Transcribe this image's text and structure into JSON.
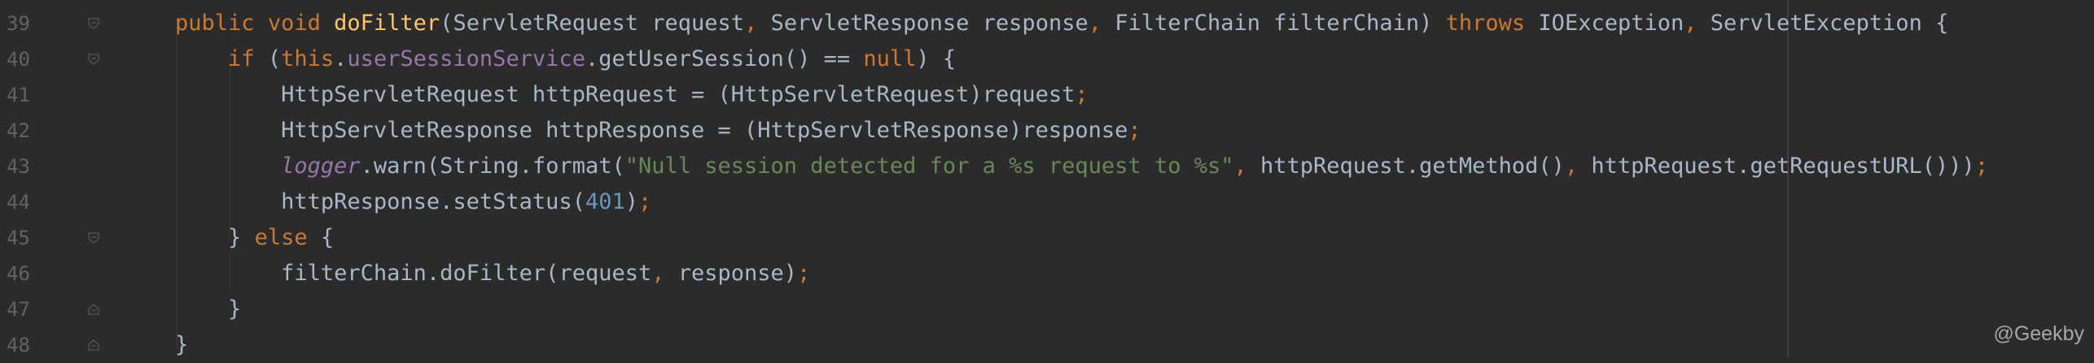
{
  "editor": {
    "line_numbers": [
      "39",
      "40",
      "41",
      "42",
      "43",
      "44",
      "45",
      "46",
      "47",
      "48"
    ],
    "lines": {
      "l39": {
        "indent": "    ",
        "t1": "public",
        "t2": " ",
        "t3": "void",
        "t4": " ",
        "t5": "doFilter",
        "t6": "(ServletRequest request",
        "t7": ",",
        "t8": " ServletResponse response",
        "t9": ",",
        "t10": " FilterChain filterChain) ",
        "t11": "throws",
        "t12": " IOException",
        "t13": ",",
        "t14": " ServletException {"
      },
      "l40": {
        "indent": "        ",
        "t1": "if",
        "t2": " (",
        "t3": "this",
        "t4": ".",
        "t5": "userSessionService",
        "t6": ".getUserSession() == ",
        "t7": "null",
        "t8": ") {"
      },
      "l41": {
        "indent": "            ",
        "t1": "HttpServletRequest httpRequest = (HttpServletRequest)request",
        "t2": ";"
      },
      "l42": {
        "indent": "            ",
        "t1": "HttpServletResponse httpResponse = (HttpServletResponse)response",
        "t2": ";"
      },
      "l43": {
        "indent": "            ",
        "t1": "logger",
        "t2": ".warn(String.format(",
        "t3": "\"Null session detected for a %s request to %s\"",
        "t4": ",",
        "t5": " httpRequest.getMethod()",
        "t6": ",",
        "t7": " httpRequest.getRequestURL()))",
        "t8": ";"
      },
      "l44": {
        "indent": "            ",
        "t1": "httpResponse.setStatus(",
        "t2": "401",
        "t3": ")",
        "t4": ";"
      },
      "l45": {
        "indent": "        ",
        "t1": "} ",
        "t2": "else",
        "t3": " {"
      },
      "l46": {
        "indent": "            ",
        "t1": "filterChain.doFilter(request",
        "t2": ",",
        "t3": " response)",
        "t4": ";"
      },
      "l47": {
        "indent": "        ",
        "t1": "}"
      },
      "l48": {
        "indent": "    ",
        "t1": "}"
      }
    },
    "colors": {
      "background": "#2b2b2b",
      "keyword": "#cc7832",
      "method_declaration": "#ffc66d",
      "field": "#9876aa",
      "string": "#6a8759",
      "number": "#6897bb",
      "plain": "#a9b7c6",
      "line_number": "#606366"
    },
    "icons": {
      "fold_open": "fold-open-icon",
      "fold_end": "fold-end-icon"
    }
  },
  "watermark": "@Geekby"
}
